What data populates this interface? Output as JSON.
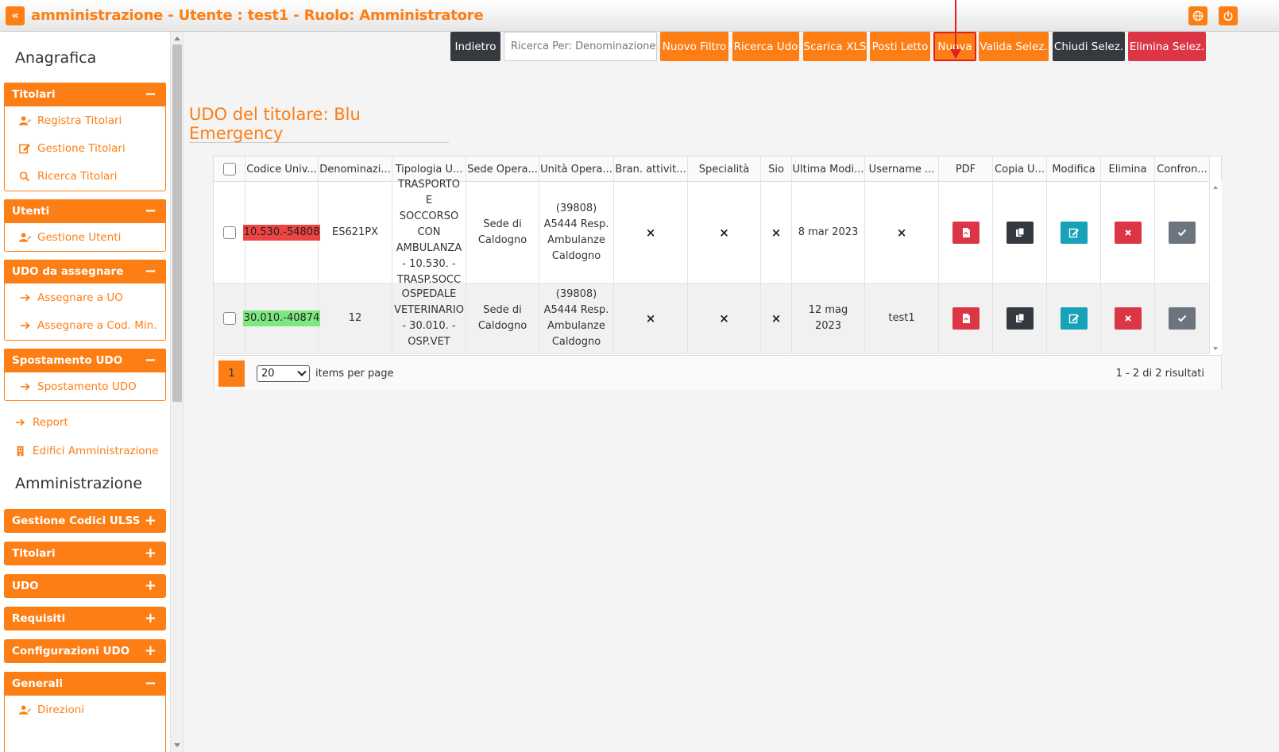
{
  "header": {
    "title": "amministrazione - Utente : test1 - Ruolo: Amministratore",
    "collapse_glyph": "«",
    "collapse_icon": "double-chevron-left-icon",
    "right_icons": [
      "globe-icon",
      "power-icon"
    ],
    "accent_color": "#fd7e14"
  },
  "sidebar": {
    "section1_title": "Anagrafica",
    "section2_title": "Amministrazione",
    "panels": [
      {
        "title": "Titolari",
        "sign": "−",
        "items": [
          {
            "label": "Registra Titolari",
            "icon": "user-edit-icon"
          },
          {
            "label": "Gestione Titolari",
            "icon": "edit-icon"
          },
          {
            "label": "Ricerca Titolari",
            "icon": "search-icon"
          }
        ]
      },
      {
        "title": "Utenti",
        "sign": "−",
        "items": [
          {
            "label": "Gestione Utenti",
            "icon": "user-edit-icon"
          }
        ]
      },
      {
        "title": "UDO da assegnare",
        "sign": "−",
        "items": [
          {
            "label": "Assegnare a UO",
            "icon": "arrow-right-icon"
          },
          {
            "label": "Assegnare a Cod. Min.",
            "icon": "arrow-right-icon"
          }
        ]
      },
      {
        "title": "Spostamento UDO",
        "sign": "−",
        "items": [
          {
            "label": "Spostamento UDO",
            "icon": "arrow-right-icon"
          }
        ]
      }
    ],
    "loose_items": [
      {
        "label": "Report",
        "icon": "arrow-right-icon"
      },
      {
        "label": "Edifici Amministrazione",
        "icon": "building-icon"
      }
    ],
    "admin_panels": [
      {
        "title": "Gestione Codici ULSS",
        "sign": "+"
      },
      {
        "title": "Titolari",
        "sign": "+"
      },
      {
        "title": "UDO",
        "sign": "+"
      },
      {
        "title": "Requisiti",
        "sign": "+"
      },
      {
        "title": "Configurazioni UDO",
        "sign": "+"
      },
      {
        "title": "Generali",
        "sign": "−",
        "items": [
          {
            "label": "Direzioni",
            "icon": "user-edit-icon"
          }
        ]
      }
    ]
  },
  "toolbar": {
    "back": "Indietro",
    "search_placeholder": "Ricerca Per: Denominazione...",
    "new_filter": "Nuovo Filtro",
    "search_udo": "Ricerca Udo",
    "download_xls": "Scarica XLS",
    "beds": "Posti Letto",
    "new": "Nuova",
    "validate_sel": "Valida Selez.",
    "close_sel": "Chiudi Selez.",
    "delete_sel": "Elimina Selez."
  },
  "page": {
    "title": "UDO del titolare: Blu Emergency"
  },
  "table": {
    "columns": [
      "Codice Univ...",
      "Denominazi...",
      "Tipologia U...",
      "Sede Opera...",
      "Unità Opera...",
      "Bran. attivit...",
      "Specialità",
      "Sio",
      "Ultima Modi...",
      "Username ...",
      "PDF",
      "Copia U...",
      "Modifica",
      "Elimina",
      "Confron..."
    ],
    "rows": [
      {
        "code": "10.530.-54808",
        "code_color": "#ee4444",
        "name": "ES621PX",
        "type_lines": [
          "TRASPORTO E",
          "SOCCORSO",
          "CON",
          "AMBULANZA",
          "- 10.530. -",
          "TRASP.SOCC"
        ],
        "site_lines": [
          "Sede di",
          "Caldogno"
        ],
        "unit_lines": [
          "(39808)",
          "A5444 Resp.",
          "Ambulanze",
          "Caldogno"
        ],
        "branch": "×",
        "specialty": "×",
        "sio": "×",
        "modified": "8 mar 2023",
        "username": "×"
      },
      {
        "code": "30.010.-40874",
        "code_color": "#7ee87e",
        "name": "12",
        "type_lines": [
          "OSPEDALE",
          "VETERINARIO",
          "- 30.010. -",
          "OSP.VET"
        ],
        "site_lines": [
          "Sede di",
          "Caldogno"
        ],
        "unit_lines": [
          "(39808)",
          "A5444 Resp.",
          "Ambulanze",
          "Caldogno"
        ],
        "branch": "×",
        "specialty": "×",
        "sio": "×",
        "modified": "12 mag 2023",
        "username": "test1"
      }
    ]
  },
  "pager": {
    "current_page": "1",
    "page_size": "20",
    "per_page_label": "items per page",
    "summary": "1 - 2 di 2 risultati"
  }
}
